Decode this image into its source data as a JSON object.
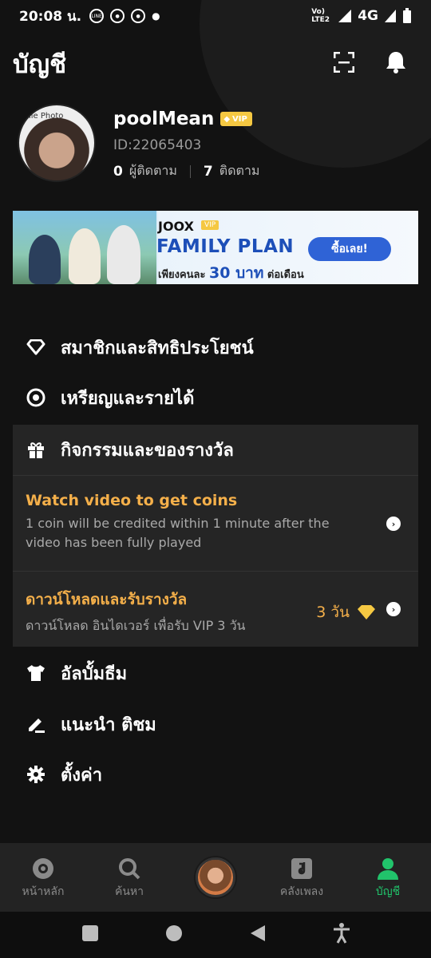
{
  "status": {
    "time": "20:08 น.",
    "network": "4G",
    "volte": "Vo) LTE2"
  },
  "header": {
    "title": "บัญชี",
    "scan_icon": "scan-icon",
    "bell_icon": "bell-icon"
  },
  "profile": {
    "avatar_caption": "ile Photo",
    "name": "poolMean",
    "vip_badge": "VIP",
    "id": "ID:22065403",
    "followers_count": "0",
    "followers_label": "ผู้ติดตาม",
    "following_count": "7",
    "following_label": "ติดตาม"
  },
  "banner": {
    "logo": "JOOX",
    "vip_tag": "VIP",
    "plan": "FAMILY PLAN",
    "price_prefix": "เพียงคนละ",
    "price_value": "30 บาท",
    "price_suffix": "ต่อเดือน",
    "buy_label": "ซื้อเลย!"
  },
  "menu": {
    "membership": "สมาชิกและสิทธิประโยชน์",
    "coins": "เหรียญและรายได้",
    "activities": "กิจกรรมและของรางวัล",
    "album": "อัลบั้มธีม",
    "suggest": "แนะนำ ติชม",
    "settings": "ตั้งค่า"
  },
  "panel": {
    "video_title": "Watch video to get coins",
    "video_sub": "1 coin will be credited within 1 minute after the video has been fully played",
    "download_title": "ดาวน์โหลดและรับรางวัล",
    "download_sub": "ดาวน์โหลด อินไดเวอร์ เพื่อรับ VIP 3 วัน",
    "download_reward": "3 วัน"
  },
  "nav": {
    "home": "หน้าหลัก",
    "search": "ค้นหา",
    "library": "คลังเพลง",
    "account": "บัญชี"
  },
  "colors": {
    "accent_green": "#21c36b",
    "gold": "#f5b04a",
    "vip_gold": "#f5c842",
    "background": "#121212"
  }
}
